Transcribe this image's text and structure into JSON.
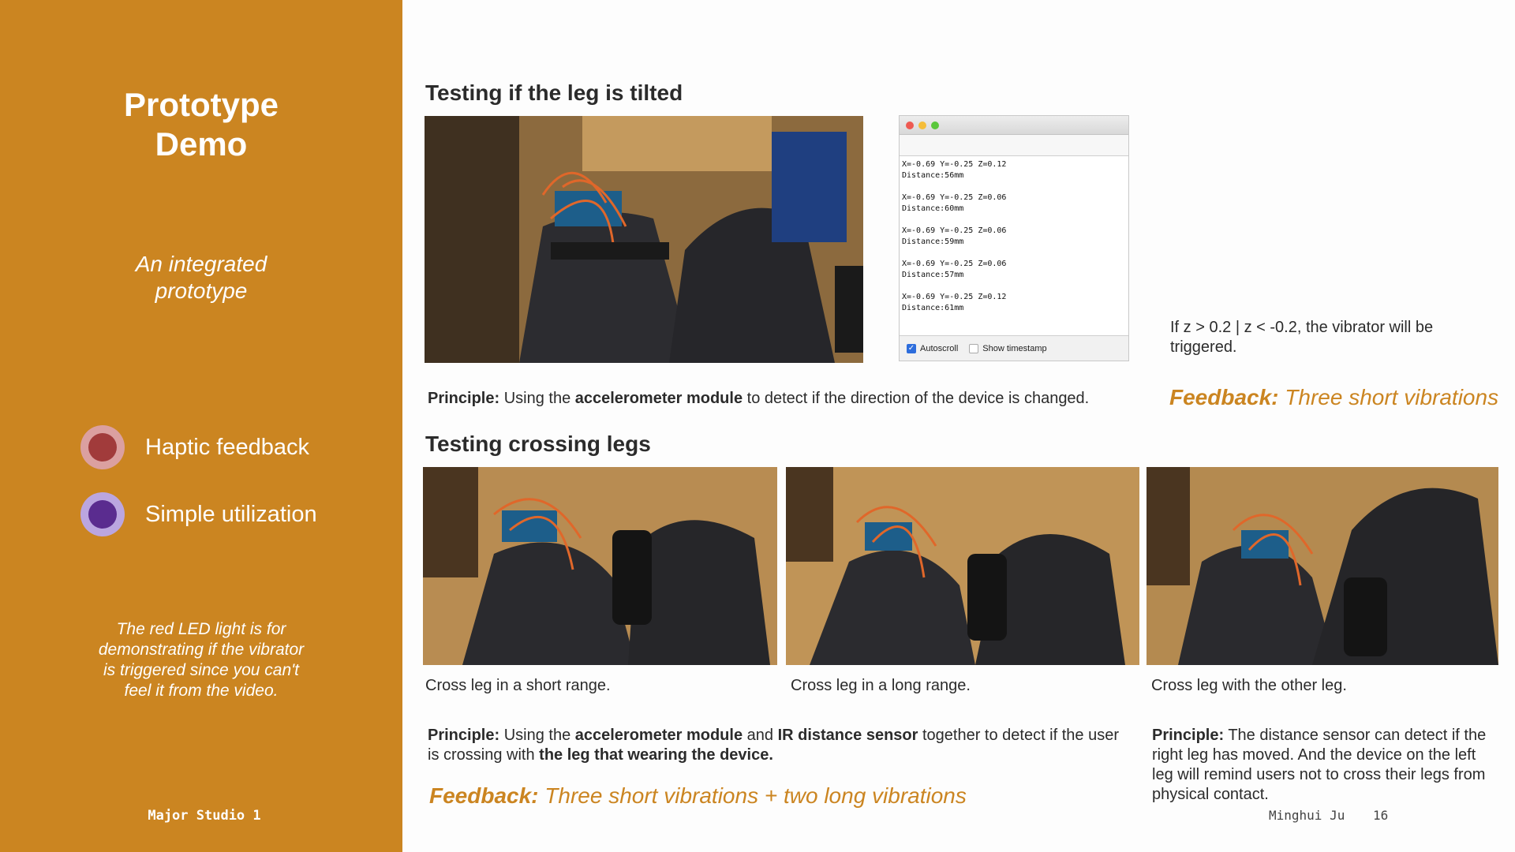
{
  "sidebar": {
    "title_line1": "Prototype",
    "title_line2": "Demo",
    "subtitle_line1": "An integrated",
    "subtitle_line2": "prototype",
    "features": [
      {
        "label": "Haptic feedback",
        "color": "#a13b3b",
        "ring": "#dba0a0"
      },
      {
        "label": "Simple utilization",
        "color": "#5a2c8f",
        "ring": "#bba6e0"
      }
    ],
    "note": "The red LED light is for demonstrating if the vibrator is triggered since you can't feel it from the video.",
    "footer": "Major Studio 1"
  },
  "section1": {
    "heading": "Testing if the leg is tilted",
    "principle_label": "Principle:",
    "principle_pre": " Using the ",
    "principle_bold": "accelerometer module",
    "principle_post": " to detect if the direction of the device is changed.",
    "note": "If z > 0.2 | z < -0.2, the vibrator will be triggered.",
    "feedback_label": "Feedback:",
    "feedback_text": " Three short vibrations",
    "serial": {
      "lines": [
        [
          "X=-0.69  Y=-0.25  Z=0.12",
          "Distance:56mm"
        ],
        [
          "X=-0.69  Y=-0.25  Z=0.06",
          "Distance:60mm"
        ],
        [
          "X=-0.69  Y=-0.25  Z=0.06",
          "Distance:59mm"
        ],
        [
          "X=-0.69  Y=-0.25  Z=0.06",
          "Distance:57mm"
        ],
        [
          "X=-0.69  Y=-0.25  Z=0.12",
          "Distance:61mm"
        ]
      ],
      "autoscroll_label": "Autoscroll",
      "timestamp_label": "Show timestamp"
    }
  },
  "section2": {
    "heading": "Testing crossing legs",
    "captions": [
      "Cross leg in a short range.",
      "Cross leg in a long range.",
      "Cross leg with the other leg."
    ],
    "principle_label": "Principle:",
    "principle_a": " Using the ",
    "principle_b": "accelerometer module",
    "principle_c": " and ",
    "principle_d": "IR distance sensor",
    "principle_e": " together to detect if the user is crossing with ",
    "principle_f": "the leg that wearing the device.",
    "feedback_label": "Feedback:",
    "feedback_text": " Three short vibrations +  two long vibrations",
    "principle2_label": "Principle:",
    "principle2_text": " The distance sensor can detect if the right leg has moved. And the device on the left leg will remind users not to cross their legs from physical contact."
  },
  "footer": {
    "author": "Minghui Ju",
    "page": "16"
  }
}
